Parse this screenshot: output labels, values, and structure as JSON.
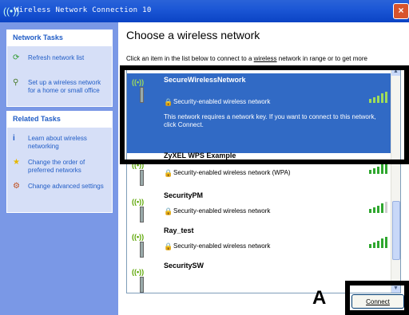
{
  "window": {
    "title": "Wireless Network Connection 10",
    "close_glyph": "×"
  },
  "sidebar": {
    "network_tasks": {
      "header": "Network Tasks",
      "items": [
        {
          "label": "Refresh network list",
          "icon": "refresh-icon"
        },
        {
          "label": "Set up a wireless network for a home or small office",
          "icon": "setup-network-icon"
        }
      ]
    },
    "related_tasks": {
      "header": "Related Tasks",
      "items": [
        {
          "label": "Learn about wireless networking",
          "icon": "info-icon"
        },
        {
          "label": "Change the order of preferred networks",
          "icon": "star-icon"
        },
        {
          "label": "Change advanced settings",
          "icon": "settings-icon"
        }
      ]
    }
  },
  "main": {
    "heading": "Choose a wireless network",
    "hint_prefix": "Click an item in the list below to connect to a ",
    "hint_link": "wireless",
    "hint_suffix": " network in range or to get more",
    "networks": [
      {
        "name": "SecureWirelessNetwork",
        "type": "Security-enabled wireless network",
        "description": "This network requires a network key. If you want to connect to this network, click Connect.",
        "selected": true
      },
      {
        "name": "ZyXEL WPS Example",
        "type": "Security-enabled wireless network (WPA)",
        "selected": false
      },
      {
        "name": "SecurityPM",
        "type": "Security-enabled wireless network",
        "selected": false
      },
      {
        "name": "Ray_test",
        "type": "Security-enabled wireless network",
        "selected": false
      },
      {
        "name": "SecuritySW",
        "type": "",
        "selected": false
      }
    ],
    "connect_button": "Connect"
  },
  "callouts": {
    "a_label": "A"
  },
  "colors": {
    "selection": "#316ac5",
    "callout": "#000000",
    "signal_bars": "#2fa72f"
  }
}
